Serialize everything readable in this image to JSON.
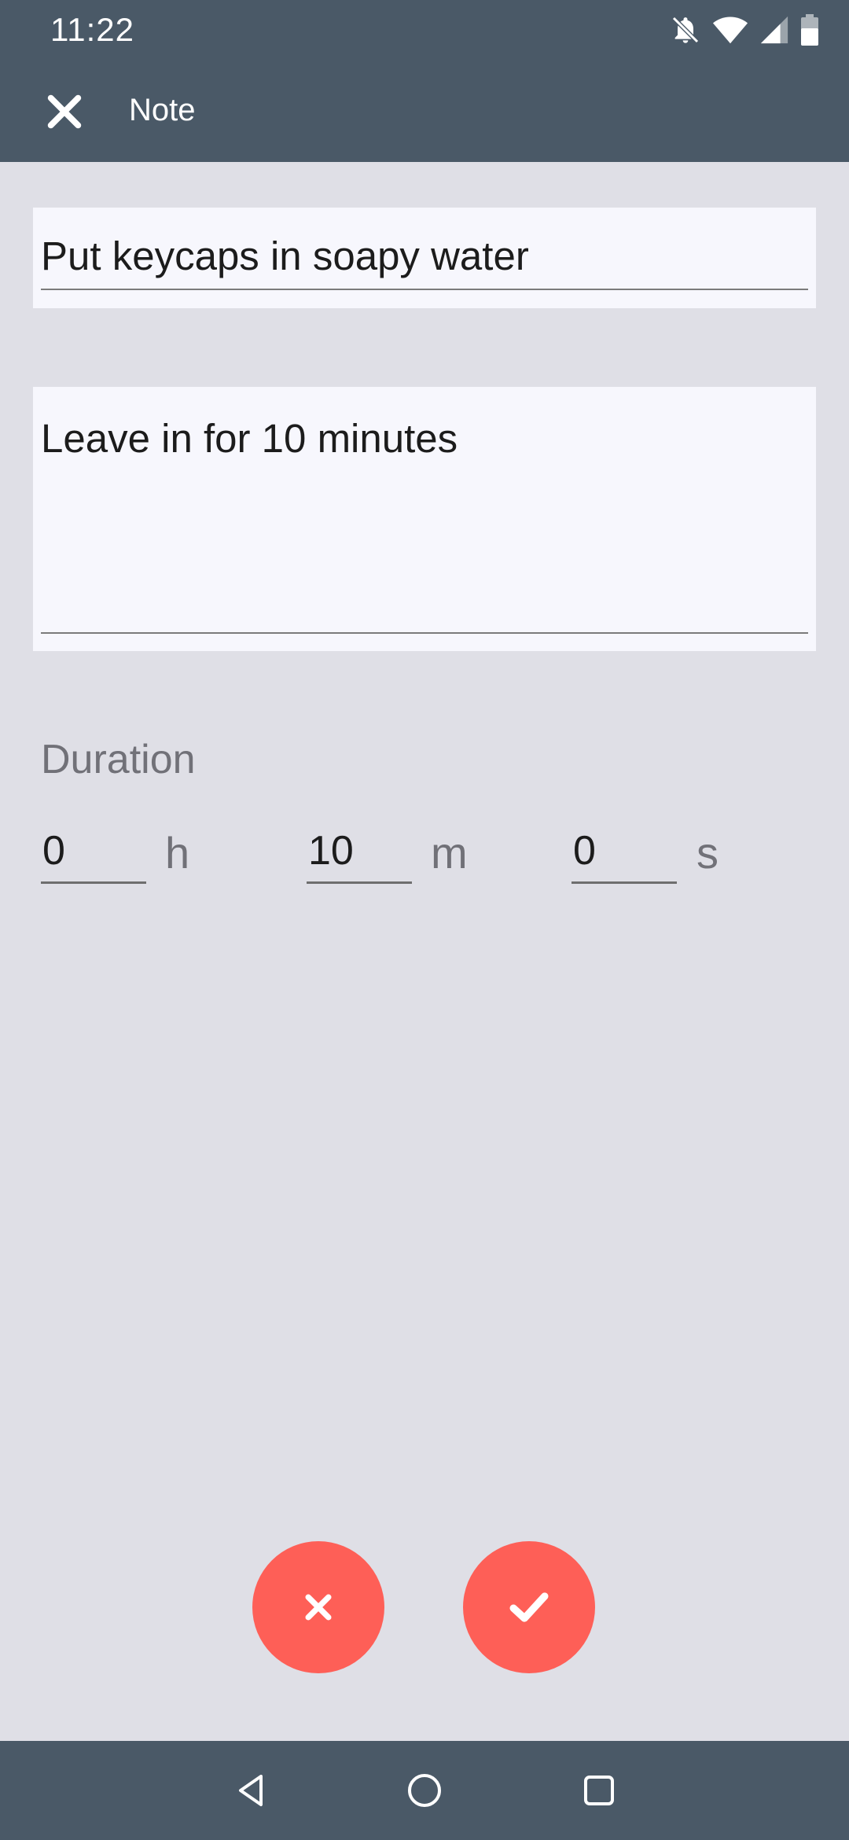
{
  "status_bar": {
    "time": "11:22",
    "icons": [
      "bell-off-icon",
      "wifi-icon",
      "signal-icon",
      "battery-icon"
    ]
  },
  "app_bar": {
    "title": "Note",
    "close_icon": "close-icon"
  },
  "note": {
    "title_value": "Put keycaps in soapy water",
    "description_value": "Leave in for 10 minutes"
  },
  "duration": {
    "label": "Duration",
    "hours_value": "0",
    "hours_unit": "h",
    "minutes_value": "10",
    "minutes_unit": "m",
    "seconds_value": "0",
    "seconds_unit": "s"
  },
  "actions": {
    "cancel_icon": "close-icon",
    "confirm_icon": "check-icon"
  },
  "nav_bar": {
    "back_icon": "back-triangle-icon",
    "home_icon": "home-circle-icon",
    "recent_icon": "recents-square-icon"
  },
  "colors": {
    "bar": "#4a5967",
    "background": "#dfdfe6",
    "field": "#f7f7fd",
    "fab": "#fe5f57"
  }
}
